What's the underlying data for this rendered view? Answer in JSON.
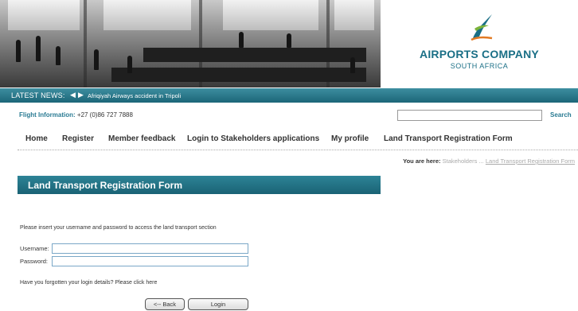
{
  "header": {
    "logo_line1": "AIRPORTS COMPANY",
    "logo_line2": "SOUTH AFRICA",
    "brand_color": "#1a6f86"
  },
  "news": {
    "label": "LATEST NEWS:",
    "prev_icon": "chevron-left-icon",
    "next_icon": "chevron-right-icon",
    "headline": "Afriqiyah Airways accident in Tripoli"
  },
  "flight": {
    "label": "Flight Information:",
    "phone": "+27 (0)86 727 7888"
  },
  "search": {
    "value": "",
    "button_label": "Search"
  },
  "menu": {
    "items": [
      {
        "label": "Home"
      },
      {
        "label": "Register"
      },
      {
        "label": "Member feedback"
      },
      {
        "label": "Login to Stakeholders applications"
      },
      {
        "label": "My profile"
      },
      {
        "label": "Land Transport Registration Form"
      }
    ]
  },
  "breadcrumb": {
    "prefix": "You are here:",
    "part1": "Stakeholders",
    "sep": "...",
    "current": "Land Transport Registration Form"
  },
  "page": {
    "title": "Land Transport Registration Form",
    "intro": "Please insert your username and password to access the land transport section",
    "username_label": "Username:",
    "password_label": "Password:",
    "username_value": "",
    "password_value": "",
    "forgot_text": "Have you forgotten your login details? Please click here",
    "back_label": "<-- Back",
    "login_label": "Login"
  }
}
